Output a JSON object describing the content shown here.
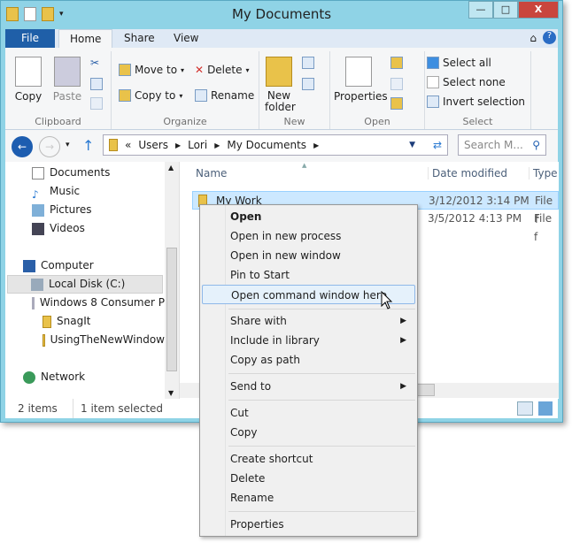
{
  "window": {
    "title": "My Documents",
    "caption": {
      "min": "—",
      "max": "□",
      "close": "X"
    }
  },
  "tabs": [
    "File",
    "Home",
    "Share",
    "View"
  ],
  "ribbon": {
    "clipboard": {
      "label": "Clipboard",
      "copy": "Copy",
      "paste": "Paste"
    },
    "organize": {
      "label": "Organize",
      "move_to": "Move to",
      "copy_to": "Copy to",
      "delete": "Delete",
      "rename": "Rename"
    },
    "new": {
      "label": "New",
      "new_folder_1": "New",
      "new_folder_2": "folder"
    },
    "open": {
      "label": "Open",
      "properties": "Properties"
    },
    "select": {
      "label": "Select",
      "select_all": "Select all",
      "select_none": "Select none",
      "invert": "Invert selection"
    }
  },
  "address": {
    "overflow": "«",
    "crumbs": [
      "Users",
      "Lori",
      "My Documents"
    ],
    "search_placeholder": "Search M..."
  },
  "nav": {
    "items": [
      "Documents",
      "Music",
      "Pictures",
      "Videos",
      "Computer",
      "Local Disk (C:)",
      "Windows 8 Consumer P",
      "SnagIt",
      "UsingTheNewWindow",
      "Network"
    ]
  },
  "files": {
    "headers": [
      "Name",
      "Date modified",
      "Type"
    ],
    "rows": [
      {
        "name": "My Work",
        "date": "3/12/2012 3:14 PM",
        "type": "File f"
      },
      {
        "name": "",
        "date": "3/5/2012 4:13 PM",
        "type": "File f"
      }
    ]
  },
  "status": {
    "count": "2 items",
    "selected": "1 item selected"
  },
  "context_menu": [
    "Open",
    "Open in new process",
    "Open in new window",
    "Pin to Start",
    "Open command window here",
    "Share with",
    "Include in library",
    "Copy as path",
    "Send to",
    "Cut",
    "Copy",
    "Create shortcut",
    "Delete",
    "Rename",
    "Properties"
  ]
}
